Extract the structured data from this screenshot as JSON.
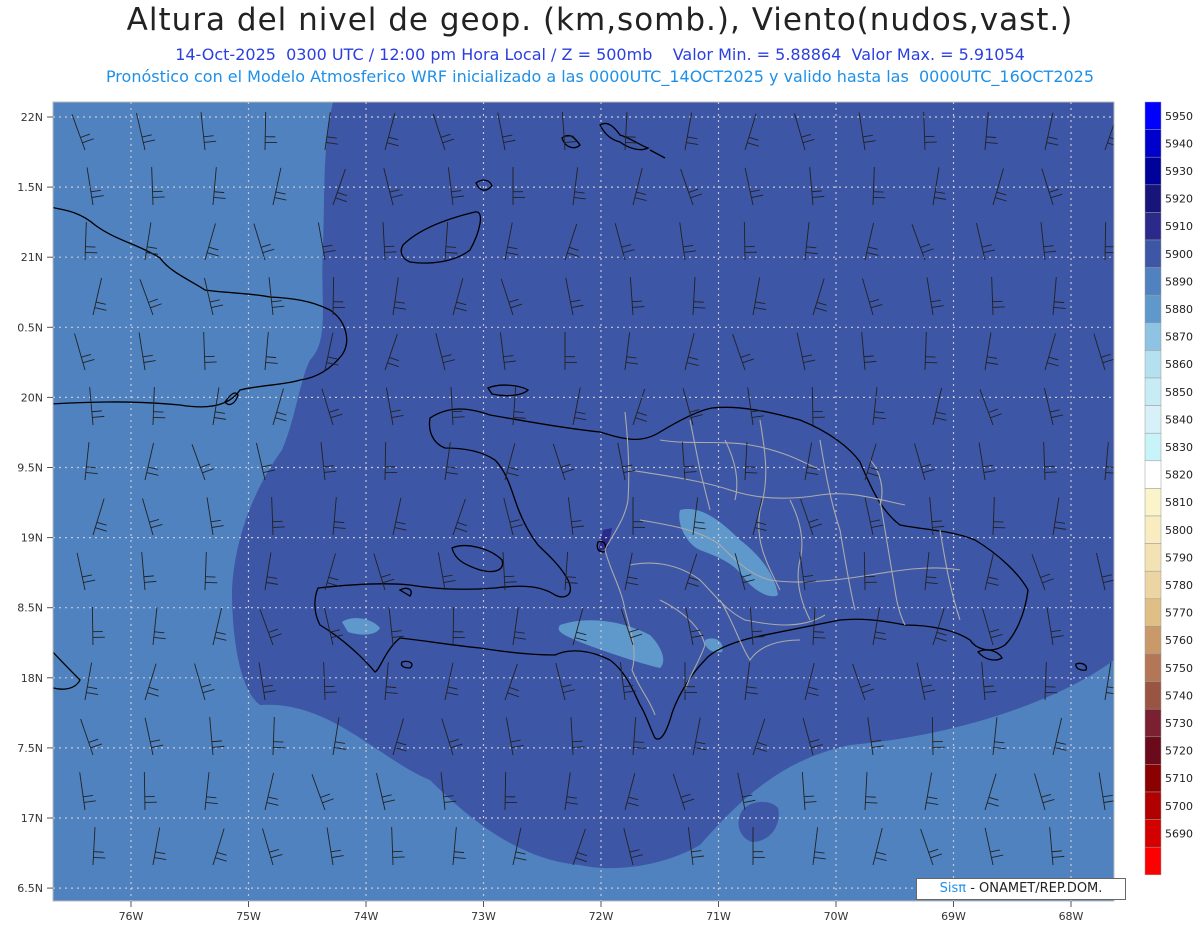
{
  "header": {
    "title": "Altura del nivel de geop. (km,somb.), Viento(nudos,vast.)",
    "subtitle": "14-Oct-2025  0300 UTC / 12:00 pm Hora Local / Z = 500mb    Valor Min. = 5.88864  Valor Max. = 5.91054",
    "description": "Pronóstico con el Modelo Atmosferico WRF inicializado a las 0000UTC_14OCT2025 y valido hasta las  0000UTC_16OCT2025"
  },
  "axes": {
    "lat_labels": [
      "22N",
      "1.5N",
      "21N",
      "0.5N",
      "20N",
      "9.5N",
      "19N",
      "8.5N",
      "18N",
      "7.5N",
      "17N",
      "6.5N"
    ],
    "lon_labels": [
      "76W",
      "75W",
      "74W",
      "73W",
      "72W",
      "71W",
      "70W",
      "69W",
      "68W"
    ]
  },
  "legend": {
    "levels": [
      "5950",
      "5940",
      "5930",
      "5920",
      "5910",
      "5900",
      "5890",
      "5880",
      "5870",
      "5860",
      "5850",
      "5840",
      "5830",
      "5820",
      "5810",
      "5800",
      "5790",
      "5780",
      "5770",
      "5760",
      "5750",
      "5740",
      "5730",
      "5720",
      "5710",
      "5700",
      "5690"
    ],
    "colors": [
      "#0000ff",
      "#0000cc",
      "#00009a",
      "#17157a",
      "#2b2a8a",
      "#3d56a6",
      "#4f82bf",
      "#5f99cc",
      "#8ec3e3",
      "#b4e0ef",
      "#c8ecf5",
      "#d8f1f8",
      "#c7f3f9",
      "#ffffff",
      "#fbf3c9",
      "#f8ecc0",
      "#f3e2b4",
      "#ecd5a2",
      "#dfbf85",
      "#c9996a",
      "#b37656",
      "#9a5442",
      "#7a2030",
      "#6a0a1a",
      "#8b0000",
      "#b00000",
      "#d40000",
      "#ff0000"
    ]
  },
  "credit": {
    "brand": "Sisπ",
    "org": " - ONAMET/REP.DOM."
  },
  "colors": {
    "field_outer": "#4f82bf",
    "field_inner": "#3d56a6",
    "field_patch": "#5f99cc",
    "coast": "#000000",
    "borders": "#aaaaaa"
  }
}
